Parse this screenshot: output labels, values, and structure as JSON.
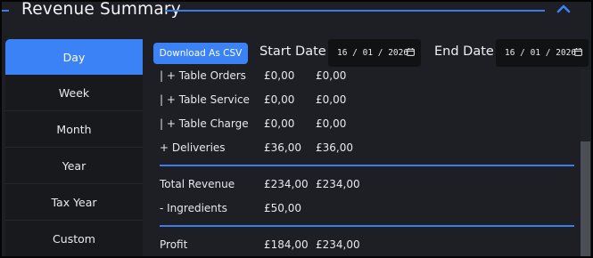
{
  "header": {
    "title": "Revenue Summary"
  },
  "sidebar": {
    "items": [
      {
        "label": "Day",
        "active": true
      },
      {
        "label": "Week"
      },
      {
        "label": "Month"
      },
      {
        "label": "Year"
      },
      {
        "label": "Tax Year"
      },
      {
        "label": "Custom"
      }
    ]
  },
  "toolbar": {
    "download_label": "Download As CSV",
    "start_label": "Start Date",
    "start_value": "16 / 01 / 2026",
    "end_label": "End Date",
    "end_value": "16 / 01 / 2026"
  },
  "rows": [
    {
      "label": "|  + Table Orders",
      "a": "£0,00",
      "b": "£0,00"
    },
    {
      "label": "|  + Table Service",
      "a": "£0,00",
      "b": "£0,00"
    },
    {
      "label": "|  + Table Charge",
      "a": "£0,00",
      "b": "£0,00"
    },
    {
      "label": "+ Deliveries",
      "a": "£36,00",
      "b": "£36,00"
    },
    {
      "label": "Total Revenue",
      "a": "£234,00",
      "b": "£234,00"
    },
    {
      "label": "- Ingredients",
      "a": "£50,00",
      "b": ""
    },
    {
      "label": "Profit",
      "a": "£184,00",
      "b": "£234,00"
    }
  ],
  "colors": {
    "accent": "#3b82f6",
    "background": "#1d1f24"
  }
}
